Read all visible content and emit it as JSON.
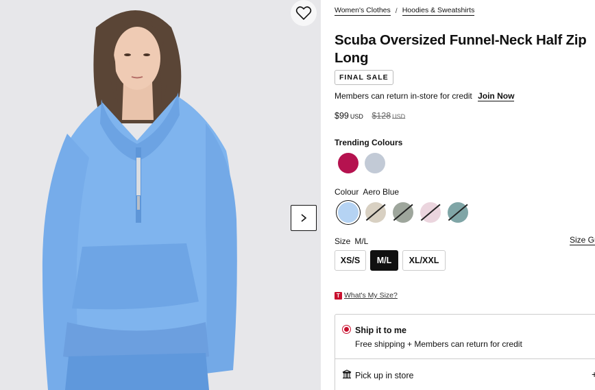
{
  "breadcrumb": [
    {
      "label": "Women's Clothes"
    },
    {
      "label": "Hoodies & Sweatshirts"
    }
  ],
  "product": {
    "title": "Scuba Oversized Funnel-Neck Half Zip Long",
    "badge": "FINAL SALE",
    "members_text": "Members can return in-store for credit",
    "join_label": "Join Now",
    "price": "$99",
    "price_currency": "USD",
    "old_price": "$128",
    "old_price_currency": "USD"
  },
  "trending": {
    "label": "Trending Colours",
    "swatches": [
      {
        "name": "magenta",
        "color": "#b5124f"
      },
      {
        "name": "light-grey-blue",
        "color": "#c2cad6"
      }
    ]
  },
  "colour": {
    "label": "Colour",
    "selected": "Aero Blue",
    "swatches": [
      {
        "name": "aero-blue",
        "color": "#b5d3f3",
        "selected": true,
        "unavailable": false
      },
      {
        "name": "beige",
        "color": "#d8d0c2",
        "selected": false,
        "unavailable": true
      },
      {
        "name": "sage-grey",
        "color": "#9ea69c",
        "selected": false,
        "unavailable": true
      },
      {
        "name": "pale-pink",
        "color": "#ebd5de",
        "selected": false,
        "unavailable": true
      },
      {
        "name": "teal",
        "color": "#7fa5a6",
        "selected": false,
        "unavailable": true
      }
    ]
  },
  "size": {
    "label": "Size",
    "selected": "M/L",
    "guide_label": "Size Gu",
    "options": [
      "XS/S",
      "M/L",
      "XL/XXL"
    ]
  },
  "whats_my_size": {
    "icon_letter": "T",
    "label": "What's My Size?"
  },
  "delivery": {
    "ship_title": "Ship it to me",
    "ship_sub": "Free shipping + Members can return for credit",
    "pickup_title": "Pick up in store",
    "pickup_plus": "+"
  },
  "image": {
    "fav_icon": "heart-icon",
    "next_icon": "chevron-right-icon",
    "garment_color": "#7fb4ee"
  }
}
